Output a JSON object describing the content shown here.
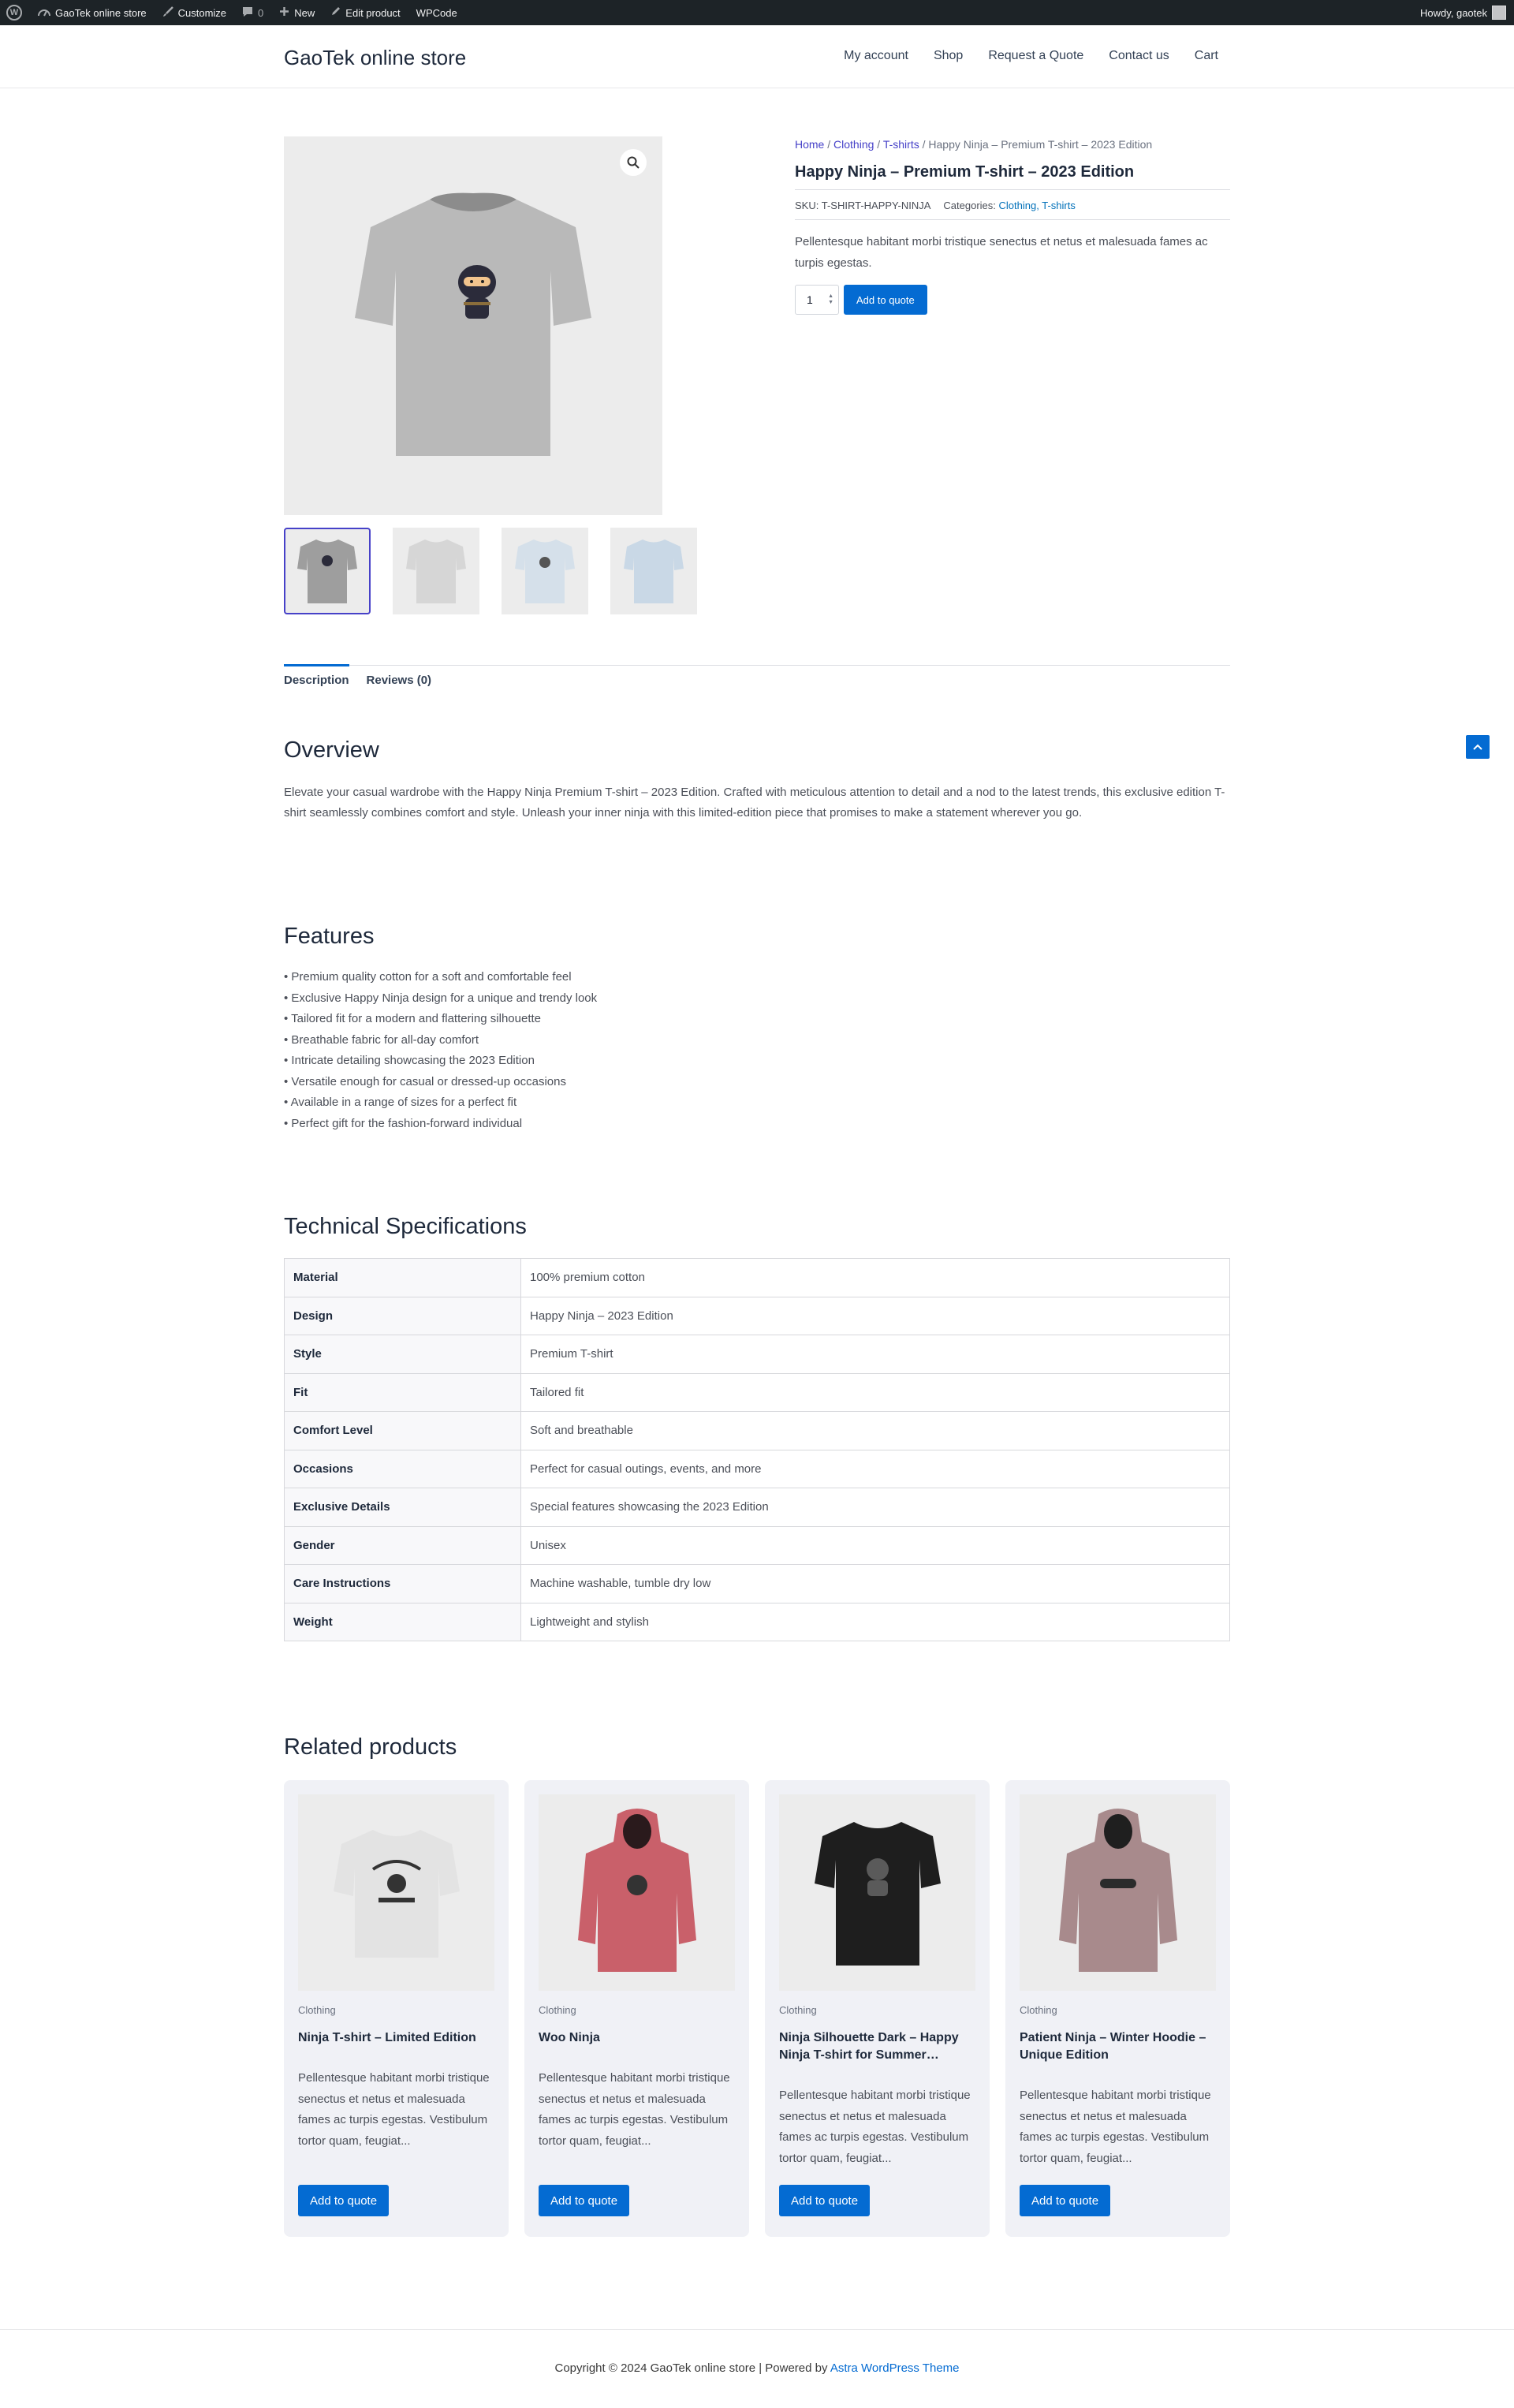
{
  "adminbar": {
    "site": "GaoTek online store",
    "customize": "Customize",
    "comments": "0",
    "new": "New",
    "edit": "Edit product",
    "wpcode": "WPCode",
    "howdy": "Howdy, gaotek"
  },
  "header": {
    "site_title": "GaoTek online store",
    "nav": [
      "My account",
      "Shop",
      "Request a Quote",
      "Contact us",
      "Cart"
    ]
  },
  "product": {
    "breadcrumb": {
      "home": "Home",
      "sep": " / ",
      "clothing": "Clothing",
      "tshirts": "T-shirts",
      "current": "Happy Ninja – Premium T-shirt – 2023 Edition"
    },
    "title": "Happy Ninja – Premium T-shirt – 2023 Edition",
    "sku_label": "SKU: T-SHIRT-HAPPY-NINJA",
    "categories_label": "Categories:",
    "category_1": "Clothing,",
    "category_2": "T-shirts",
    "short_description": "Pellentesque habitant morbi tristique senectus et netus et malesuada fames ac turpis egestas.",
    "quantity": "1",
    "add_button": "Add to quote"
  },
  "tabs": {
    "description": "Description",
    "reviews": "Reviews (0)"
  },
  "overview": {
    "heading": "Overview",
    "text": "Elevate your casual wardrobe with the Happy Ninja Premium T-shirt – 2023 Edition. Crafted with meticulous attention to detail and a nod to the latest trends, this exclusive edition T-shirt seamlessly combines comfort and style. Unleash your inner ninja with this limited-edition piece that promises to make a statement wherever you go."
  },
  "features": {
    "heading": "Features",
    "items": [
      "• Premium quality cotton for a soft and comfortable feel",
      "• Exclusive Happy Ninja design for a unique and trendy look",
      "• Tailored fit for a modern and flattering silhouette",
      "• Breathable fabric for all-day comfort",
      "• Intricate detailing showcasing the 2023 Edition",
      "• Versatile enough for casual or dressed-up occasions",
      "• Available in a range of sizes for a perfect fit",
      "• Perfect gift for the fashion-forward individual"
    ]
  },
  "specs": {
    "heading": "Technical Specifications",
    "rows": [
      {
        "k": "Material",
        "v": "100% premium cotton"
      },
      {
        "k": "Design",
        "v": "Happy Ninja – 2023 Edition"
      },
      {
        "k": "Style",
        "v": "Premium T-shirt"
      },
      {
        "k": "Fit",
        "v": "Tailored fit"
      },
      {
        "k": "Comfort Level",
        "v": "Soft and breathable"
      },
      {
        "k": "Occasions",
        "v": "Perfect for casual outings, events, and more"
      },
      {
        "k": "Exclusive Details",
        "v": "Special features showcasing the 2023 Edition"
      },
      {
        "k": "Gender",
        "v": "Unisex"
      },
      {
        "k": "Care Instructions",
        "v": "Machine washable, tumble dry low"
      },
      {
        "k": "Weight",
        "v": "Lightweight and stylish"
      }
    ]
  },
  "related": {
    "heading": "Related products",
    "items": [
      {
        "category": "Clothing",
        "title": "Ninja T-shirt – Limited Edition",
        "desc": "Pellentesque habitant morbi tristique senectus et netus et malesuada fames ac turpis egestas. Vestibulum tortor quam, feugiat...",
        "button": "Add to quote"
      },
      {
        "category": "Clothing",
        "title": "Woo Ninja",
        "desc": "Pellentesque habitant morbi tristique senectus et netus et malesuada fames ac turpis egestas. Vestibulum tortor quam, feugiat...",
        "button": "Add to quote"
      },
      {
        "category": "Clothing",
        "title": "Ninja Silhouette Dark – Happy Ninja T-shirt for Summer…",
        "desc": "Pellentesque habitant morbi tristique senectus et netus et malesuada fames ac turpis egestas. Vestibulum tortor quam, feugiat...",
        "button": "Add to quote"
      },
      {
        "category": "Clothing",
        "title": "Patient Ninja – Winter Hoodie – Unique Edition",
        "desc": "Pellentesque habitant morbi tristique senectus et netus et malesuada fames ac turpis egestas. Vestibulum tortor quam, feugiat...",
        "button": "Add to quote"
      }
    ]
  },
  "footer": {
    "copyright": "Copyright © 2024 GaoTek online store | Powered by ",
    "theme_link": "Astra WordPress Theme"
  },
  "colors": {
    "accent": "#046bd2",
    "link": "#4641c8",
    "admin_bar": "#1d2327"
  },
  "icons": [
    "wordpress-icon",
    "brush-icon",
    "comment-icon",
    "plus-icon",
    "pencil-icon",
    "magnifier-icon",
    "chevron-up-icon"
  ]
}
